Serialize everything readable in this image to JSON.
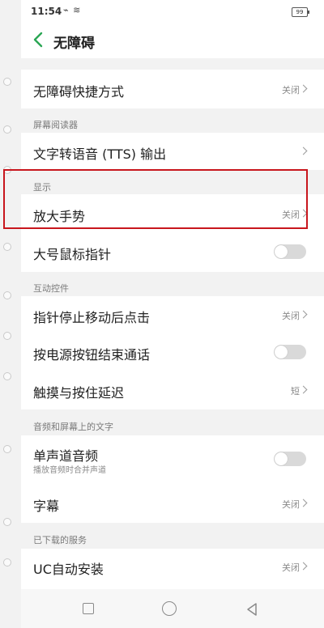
{
  "status_bar": {
    "time": "11:54",
    "icons": "⌁ ≋",
    "battery": "99"
  },
  "header": {
    "title": "无障碍"
  },
  "rows": {
    "shortcut": {
      "title": "无障碍快捷方式",
      "value": "关闭"
    },
    "tts": {
      "title": "文字转语音 (TTS) 输出"
    },
    "magnify": {
      "title": "放大手势",
      "value": "关闭"
    },
    "large_pointer": {
      "title": "大号鼠标指针",
      "toggle": false
    },
    "click_after_stop": {
      "title": "指针停止移动后点击",
      "value": "关闭"
    },
    "power_end_call": {
      "title": "按电源按钮结束通话",
      "toggle": false
    },
    "touch_hold_delay": {
      "title": "触摸与按住延迟",
      "value": "短"
    },
    "mono_audio": {
      "title": "单声道音频",
      "subtitle": "播放音频时合并声道",
      "toggle": false
    },
    "captions": {
      "title": "字幕",
      "value": "关闭"
    },
    "uc_install": {
      "title": "UC自动安装",
      "value": "关闭"
    }
  },
  "sections": {
    "screen_reader": "屏幕阅读器",
    "display": "显示",
    "interaction": "互动控件",
    "audio_text": "音频和屏幕上的文字",
    "downloaded": "已下载的服务"
  },
  "colors": {
    "highlight": "#c8161d",
    "accent": "#2aa654"
  }
}
